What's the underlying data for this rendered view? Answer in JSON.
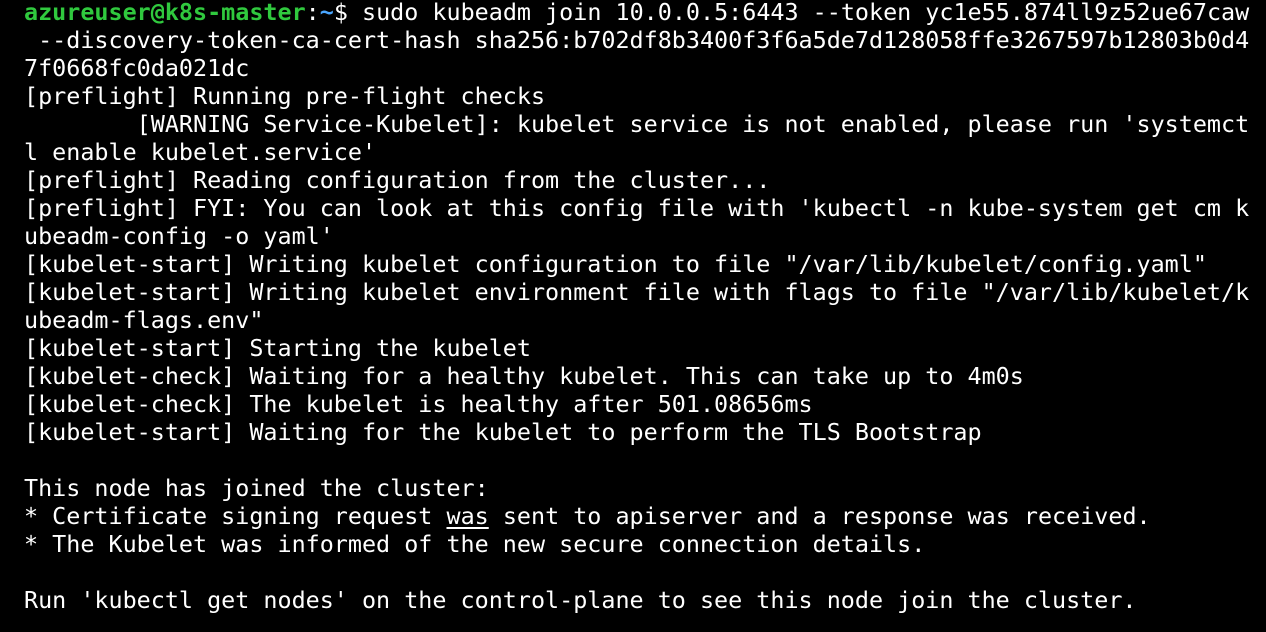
{
  "prompt": {
    "user_host": "azureuser@k8s-master",
    "separator": ":",
    "path": "~",
    "symbol": "$ ",
    "command": "sudo kubeadm join 10.0.0.5:6443 --token yc1e55.874ll9z52ue67caw"
  },
  "output": {
    "cmd_wrap_1": " --discovery-token-ca-cert-hash sha256:b702df8b3400f3f6a5de7d128058ffe3267597b12803b0d4",
    "cmd_wrap_2": "7f0668fc0da021dc",
    "l01": "[preflight] Running pre-flight checks",
    "l02": "        [WARNING Service-Kubelet]: kubelet service is not enabled, please run 'systemct",
    "l03": "l enable kubelet.service'",
    "l04": "[preflight] Reading configuration from the cluster...",
    "l05": "[preflight] FYI: You can look at this config file with 'kubectl -n kube-system get cm k",
    "l06": "ubeadm-config -o yaml'",
    "l07": "[kubelet-start] Writing kubelet configuration to file \"/var/lib/kubelet/config.yaml\"",
    "l08": "[kubelet-start] Writing kubelet environment file with flags to file \"/var/lib/kubelet/k",
    "l09": "ubeadm-flags.env\"",
    "l10": "[kubelet-start] Starting the kubelet",
    "l11": "[kubelet-check] Waiting for a healthy kubelet. This can take up to 4m0s",
    "l12": "[kubelet-check] The kubelet is healthy after 501.08656ms",
    "l13": "[kubelet-start] Waiting for the kubelet to perform the TLS Bootstrap",
    "l14": "This node has joined the cluster:",
    "l15_a": "* Certificate signing request ",
    "l15_b": "was",
    "l15_c": " sent to apiserver and a response was received.",
    "l16": "* The Kubelet was informed of the new secure connection details.",
    "l17": "Run 'kubectl get nodes' on the control-plane to see this node join the cluster."
  },
  "colors": {
    "background": "#000000",
    "text": "#ffffff",
    "user_host": "#30c93e",
    "path": "#4aa6ff"
  }
}
